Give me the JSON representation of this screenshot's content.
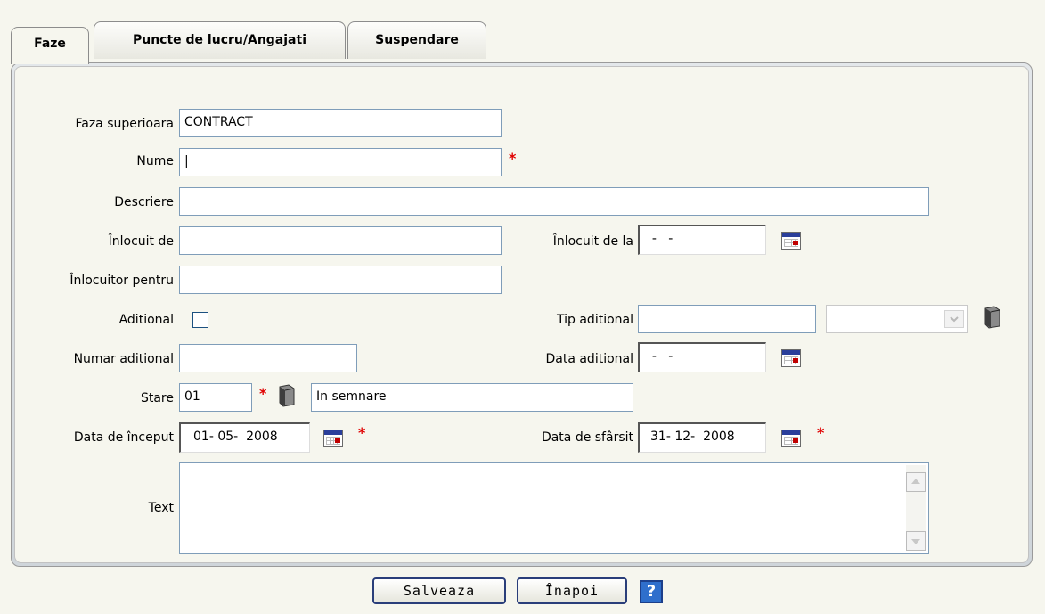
{
  "tabs": [
    {
      "label": "Faze",
      "active": true
    },
    {
      "label": "Puncte de lucru/Angajati",
      "active": false
    },
    {
      "label": "Suspendare",
      "active": false
    }
  ],
  "form": {
    "faza_superioara": {
      "label": "Faza superioara",
      "value": "CONTRACT"
    },
    "nume": {
      "label": "Nume",
      "value": "|",
      "required": true
    },
    "descriere": {
      "label": "Descriere",
      "value": ""
    },
    "inlocuit_de": {
      "label": "Înlocuit de",
      "value": ""
    },
    "inlocuit_de_la": {
      "label": "Înlocuit de la",
      "value": "  -   -"
    },
    "inlocuitor_pentru": {
      "label": "Înlocuitor pentru",
      "value": ""
    },
    "aditional": {
      "label": "Aditional",
      "checked": false
    },
    "tip_aditional": {
      "label": "Tip aditional",
      "value": "",
      "select_value": ""
    },
    "numar_aditional": {
      "label": "Numar aditional",
      "value": ""
    },
    "data_aditional": {
      "label": "Data aditional",
      "value": "  -   -"
    },
    "stare": {
      "label": "Stare",
      "code": "01",
      "description": "In semnare",
      "required": true
    },
    "data_inceput": {
      "label": "Data de început",
      "value": "01- 05-  2008",
      "required": true
    },
    "data_sfarsit": {
      "label": "Data de sfârsit",
      "value": "31- 12-  2008",
      "required": true
    },
    "text": {
      "label": "Text",
      "value": ""
    }
  },
  "required_marker": "*",
  "buttons": {
    "save_label": "Salveaza",
    "back_label": "Înapoi",
    "help_label": "?"
  },
  "colors": {
    "required": "#e00000",
    "background": "#f6f6ee",
    "help": "#2f6fcc"
  }
}
